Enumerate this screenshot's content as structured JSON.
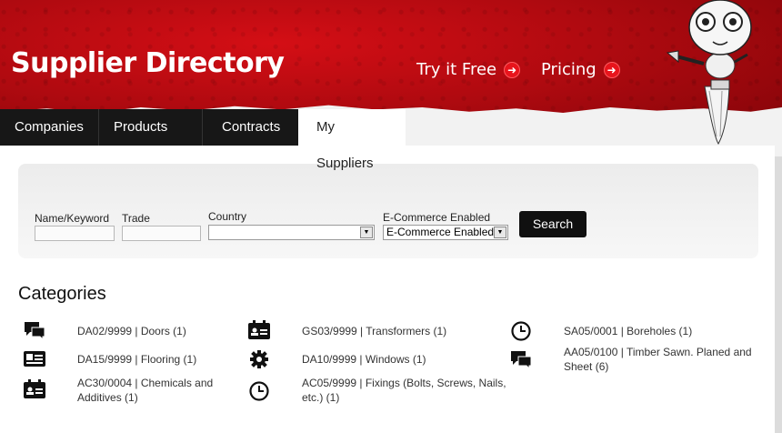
{
  "header": {
    "title": "Supplier Directory",
    "links": [
      {
        "label": "Try it Free",
        "icon": "arrow-right-icon"
      },
      {
        "label": "Pricing",
        "icon": "arrow-right-icon"
      }
    ]
  },
  "tabs": [
    {
      "label": "Companies"
    },
    {
      "label": "Products"
    },
    {
      "label": "Contracts"
    },
    {
      "label": "My Suppliers",
      "active": true
    }
  ],
  "search": {
    "name_label": "Name/Keyword",
    "name_value": "",
    "trade_label": "Trade",
    "trade_value": "",
    "country_label": "Country",
    "country_value": "",
    "ecommerce_label": "E-Commerce Enabled",
    "ecommerce_value": "E-Commerce Enabled",
    "button": "Search"
  },
  "categories": {
    "title": "Categories",
    "items": [
      {
        "label": "DA02/9999 | Doors (1)",
        "icon": "chat-bubbles-icon"
      },
      {
        "label": "DA15/9999 | Flooring (1)",
        "icon": "id-card-icon"
      },
      {
        "label": "AC30/0004 | Chemicals and Additives (1)",
        "icon": "calendar-card-icon"
      },
      {
        "label": "GS03/9999 | Transformers (1)",
        "icon": "calendar-card-icon"
      },
      {
        "label": "DA10/9999 | Windows (1)",
        "icon": "gear-icon"
      },
      {
        "label": "AC05/9999 | Fixings (Bolts, Screws, Nails, etc.) (1)",
        "icon": "clock-icon"
      },
      {
        "label": "SA05/0001 | Boreholes (1)",
        "icon": "clock-icon"
      },
      {
        "label": "AA05/0100 | Timber Sawn. Planed and Sheet (6)",
        "icon": "chat-bubbles-icon"
      }
    ]
  },
  "colors": {
    "header_red": "#b00a10",
    "tab_dark": "#171717",
    "button_dark": "#101010",
    "accent_red": "#e8141c"
  }
}
